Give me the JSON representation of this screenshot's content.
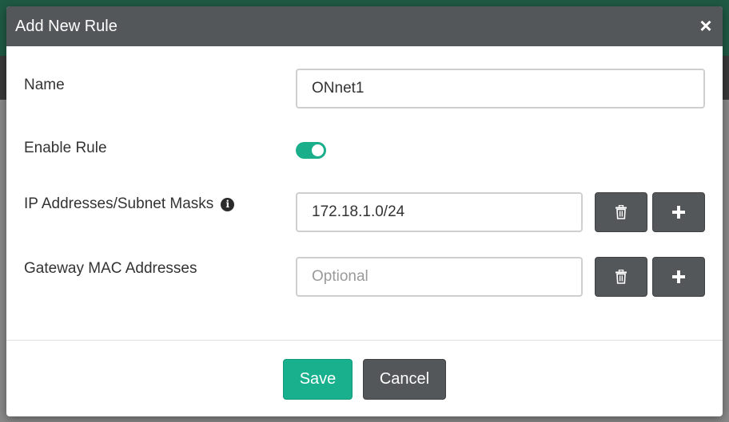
{
  "dialog": {
    "title": "Add New Rule",
    "close_symbol": "×"
  },
  "fields": {
    "name": {
      "label": "Name",
      "value": "ONnet1"
    },
    "enable_rule": {
      "label": "Enable Rule",
      "enabled": true
    },
    "ip_addresses": {
      "label": "IP Addresses/Subnet Masks",
      "value": "172.18.1.0/24",
      "info_icon": "info-circle-icon"
    },
    "gateway_mac": {
      "label": "Gateway MAC Addresses",
      "value": "",
      "placeholder": "Optional"
    }
  },
  "icons": {
    "delete": "trash-icon",
    "add": "plus-icon"
  },
  "footer": {
    "save_label": "Save",
    "cancel_label": "Cancel"
  },
  "colors": {
    "header": "#545759",
    "accent": "#19b08e",
    "secondary_button": "#545759"
  }
}
